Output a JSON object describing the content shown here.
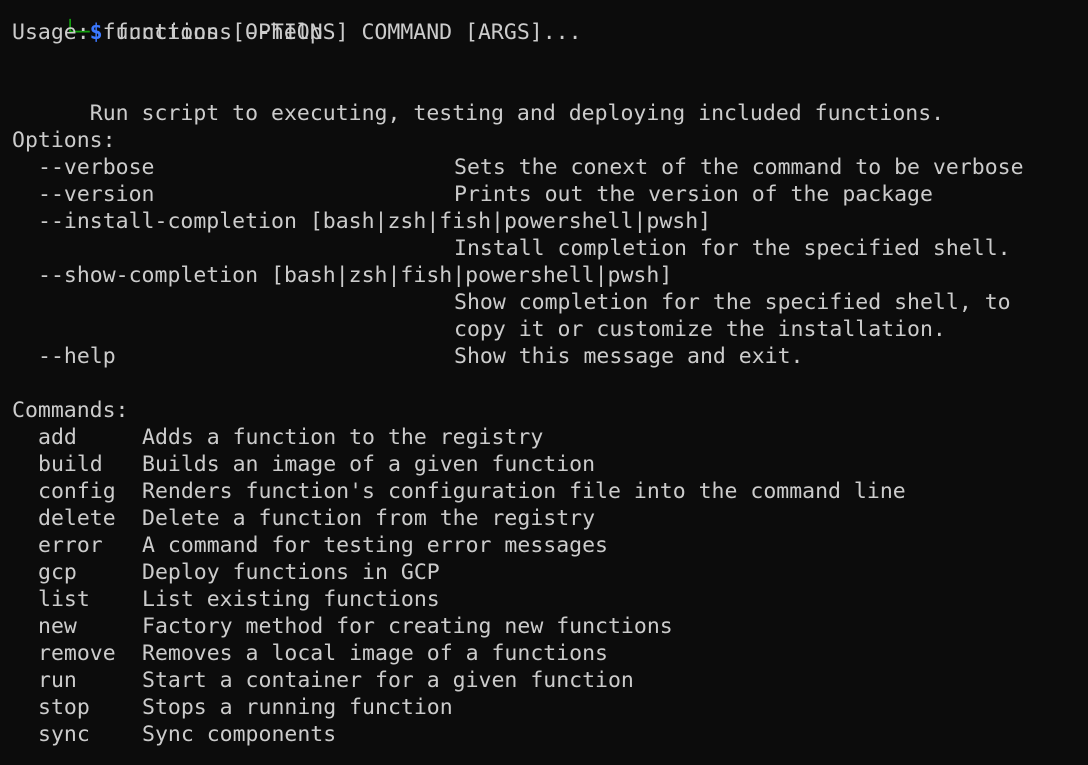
{
  "prompt": {
    "corner": "└─",
    "symbol": "$",
    "command": "functions --help"
  },
  "usage": "Usage: functions [OPTIONS] COMMAND [ARGS]...",
  "description": "Run script to executing, testing and deploying included functions.",
  "options_header": "Options:",
  "options": [
    {
      "name": "--verbose",
      "desc": "Sets the conext of the command to be verbose"
    },
    {
      "name": "--version",
      "desc": "Prints out the version of the package"
    },
    {
      "name": "--install-completion [bash|zsh|fish|powershell|pwsh]",
      "desc": ""
    },
    {
      "name": "",
      "desc": "Install completion for the specified shell."
    },
    {
      "name": "--show-completion [bash|zsh|fish|powershell|pwsh]",
      "desc": ""
    },
    {
      "name": "",
      "desc": "Show completion for the specified shell, to"
    },
    {
      "name": "",
      "desc": "copy it or customize the installation."
    },
    {
      "name": "--help",
      "desc": "Show this message and exit."
    }
  ],
  "commands_header": "Commands:",
  "commands": [
    {
      "name": "add",
      "desc": "Adds a function to the registry"
    },
    {
      "name": "build",
      "desc": "Builds an image of a given function"
    },
    {
      "name": "config",
      "desc": "Renders function's configuration file into the command line"
    },
    {
      "name": "delete",
      "desc": "Delete a function from the registry"
    },
    {
      "name": "error",
      "desc": "A command for testing error messages"
    },
    {
      "name": "gcp",
      "desc": "Deploy functions in GCP"
    },
    {
      "name": "list",
      "desc": "List existing functions"
    },
    {
      "name": "new",
      "desc": "Factory method for creating new functions"
    },
    {
      "name": "remove",
      "desc": "Removes a local image of a functions"
    },
    {
      "name": "run",
      "desc": "Start a container for a given function"
    },
    {
      "name": "stop",
      "desc": "Stops a running function"
    },
    {
      "name": "sync",
      "desc": "Sync components"
    }
  ],
  "colors": {
    "background": "#0c0c0c",
    "foreground": "#cccccc",
    "prompt_corner": "#13a10e",
    "prompt_symbol": "#3b78ff"
  }
}
